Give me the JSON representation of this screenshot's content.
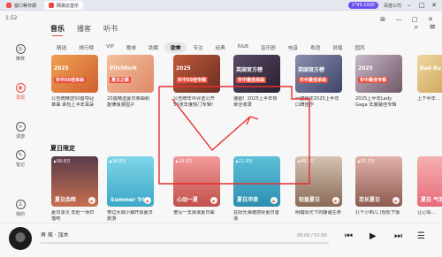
{
  "host": {
    "tabs": [
      "窗口等日期",
      "网易云音乐"
    ],
    "badge": "1*99.1000",
    "right_label": "百度公司"
  },
  "app": {
    "time": "1:52",
    "sidebar": [
      {
        "key": "recommend",
        "label": "推荐",
        "icon": "◎"
      },
      {
        "key": "discover",
        "label": "发现",
        "icon": "◉"
      },
      {
        "key": "roam",
        "label": "漫游",
        "icon": "∞"
      },
      {
        "key": "notes",
        "label": "笔记",
        "icon": "✎"
      },
      {
        "key": "mine",
        "label": "我的",
        "icon": "♙"
      }
    ],
    "top_controls": [
      "⊞",
      "—",
      "□",
      "✕"
    ],
    "head_tabs": [
      "音乐",
      "播客",
      "听书"
    ],
    "categories": [
      "精选",
      "排行榜",
      "VIP",
      "歌单",
      "助眠",
      "欧美",
      "专注",
      "经典",
      "R&B",
      "音乐剧",
      "电音",
      "粤语",
      "说唱",
      "国风"
    ],
    "row1_cards": [
      {
        "t1": "2025",
        "t2": "年中50佳单曲",
        "desc": "公告牌精选50首夺冠单曲 承包上半年耳朵"
      },
      {
        "t1": "Pitchfork",
        "t2": "夏日之歌",
        "desc": "20首精选夏日单曲和旋律浪漫因子"
      },
      {
        "t1": "2025",
        "t2": "年中50佳专辑",
        "desc": "公告牌年中评选公开 50张年度热门专辑！"
      },
      {
        "t1": "英国官方榜",
        "t2": "年中最佳单曲",
        "desc": "速戳！2025上半年热单全收录"
      },
      {
        "t1": "英国官方榜",
        "t2": "年中最佳单曲",
        "desc": "一键锁定2025上半年口碑佳作"
      },
      {
        "t1": "2025",
        "t2": "年中最佳专辑",
        "desc": "2025上半年Lady Gaga 年度最佳专辑"
      },
      {
        "t1": "Bad Bu",
        "t2": "",
        "desc": "上下半年..."
      }
    ],
    "section2_title": "夏日限定",
    "row2_cards": [
      {
        "count": "58.8万",
        "label": "夏日余晖",
        "desc": "夏日凉灵 去赶一场日落吧"
      },
      {
        "count": "26.8万",
        "label": "Summer Trip",
        "desc": "穿过大城小镇开启夏日旅游"
      },
      {
        "count": "14.3万",
        "label": "心动一夏",
        "desc": "谱写一支浪漫夏日曲"
      },
      {
        "count": "11.9万",
        "label": "夏日冲浪",
        "desc": "在阳光海滩感受夏日音浪"
      },
      {
        "count": "49.2万",
        "label": "轻盈夏日",
        "desc": "明媚阳光下的静谧生命"
      },
      {
        "count": "31.2万",
        "label": "恋长夏日",
        "desc": "打个小响儿 (轻松下饭"
      },
      {
        "count": "",
        "label": "夏日 气泡",
        "desc": "让心情..."
      }
    ]
  },
  "player": {
    "title": "再 难 · 加木",
    "time": "00:00 / 02:50",
    "progress": 0,
    "controls": [
      "⏮",
      "▶",
      "⏭",
      "☰"
    ]
  }
}
